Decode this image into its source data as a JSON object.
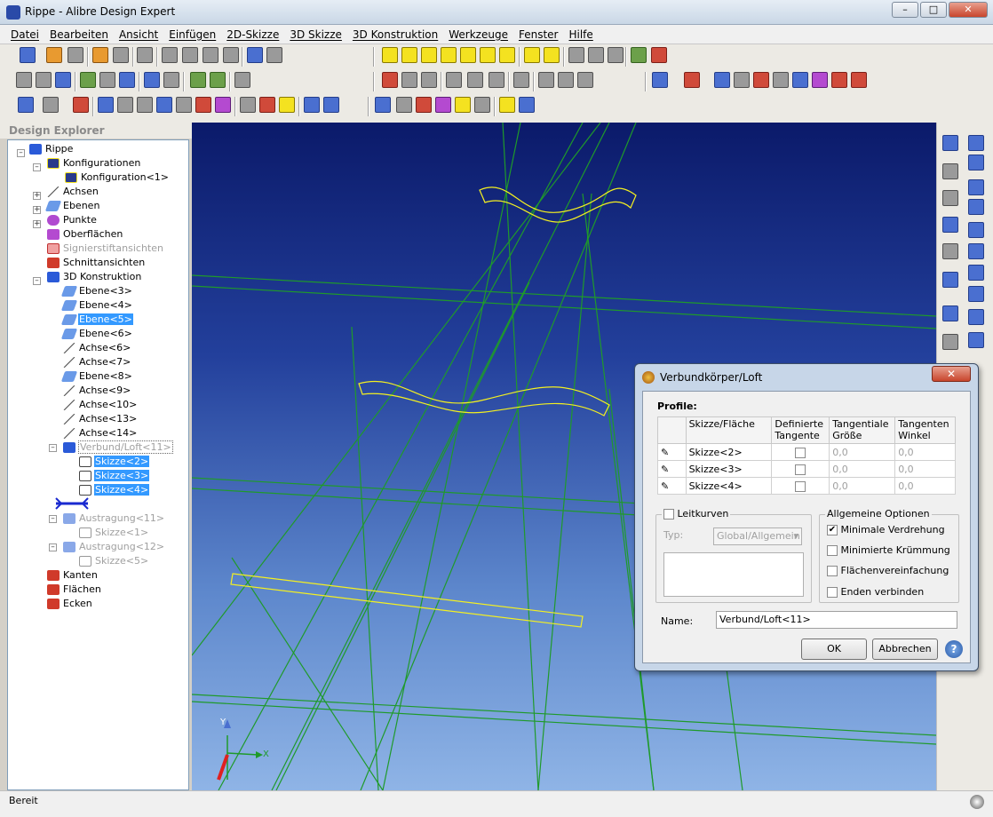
{
  "window": {
    "title": "Rippe - Alibre Design Expert",
    "minimize": "–",
    "maximize": "□",
    "close": "✕"
  },
  "menu": [
    "Datei",
    "Bearbeiten",
    "Ansicht",
    "Einfügen",
    "2D-Skizze",
    "3D Skizze",
    "3D Konstruktion",
    "Werkzeuge",
    "Fenster",
    "Hilfe"
  ],
  "explorer": {
    "title": "Design Explorer",
    "items": [
      {
        "label": "Rippe"
      },
      {
        "label": "Konfigurationen"
      },
      {
        "label": "Konfiguration<1>"
      },
      {
        "label": "Achsen"
      },
      {
        "label": "Ebenen"
      },
      {
        "label": "Punkte"
      },
      {
        "label": "Oberflächen"
      },
      {
        "label": "Signierstiftansichten"
      },
      {
        "label": "Schnittansichten"
      },
      {
        "label": "3D Konstruktion"
      },
      {
        "label": "Ebene<3>"
      },
      {
        "label": "Ebene<4>"
      },
      {
        "label": "Ebene<5>"
      },
      {
        "label": "Ebene<6>"
      },
      {
        "label": "Achse<6>"
      },
      {
        "label": "Achse<7>"
      },
      {
        "label": "Ebene<8>"
      },
      {
        "label": "Achse<9>"
      },
      {
        "label": "Achse<10>"
      },
      {
        "label": "Achse<13>"
      },
      {
        "label": "Achse<14>"
      },
      {
        "label": "Verbund/Loft<11>"
      },
      {
        "label": "Skizze<2>"
      },
      {
        "label": "Skizze<3>"
      },
      {
        "label": "Skizze<4>"
      },
      {
        "label": "Austragung<11>"
      },
      {
        "label": "Skizze<1>"
      },
      {
        "label": "Austragung<12>"
      },
      {
        "label": "Skizze<5>"
      },
      {
        "label": "Kanten"
      },
      {
        "label": "Flächen"
      },
      {
        "label": "Ecken"
      }
    ]
  },
  "viewport": {
    "axis_x": "X",
    "axis_y": "Y"
  },
  "status": {
    "text": "Bereit"
  },
  "dialog": {
    "title": "Verbundkörper/Loft",
    "close": "✕",
    "profiles_label": "Profile:",
    "columns": [
      "Skizze/Fläche",
      "Definierte Tangente",
      "Tangentiale Größe",
      "Tangenten Winkel"
    ],
    "rows": [
      {
        "sketch": "Skizze<2>",
        "size": "0,0",
        "angle": "0,0"
      },
      {
        "sketch": "Skizze<3>",
        "size": "0,0",
        "angle": "0,0"
      },
      {
        "sketch": "Skizze<4>",
        "size": "0,0",
        "angle": "0,0"
      }
    ],
    "guide_curves": {
      "label": "Leitkurven",
      "type_label": "Typ:",
      "type_value": "Global/Allgemein"
    },
    "general": {
      "title": "Allgemeine Optionen",
      "options": [
        {
          "label": "Minimale Verdrehung",
          "checked": "✔"
        },
        {
          "label": "Minimierte Krümmung",
          "checked": ""
        },
        {
          "label": "Flächenvereinfachung",
          "checked": ""
        },
        {
          "label": "Enden verbinden",
          "checked": ""
        }
      ]
    },
    "name_label": "Name:",
    "name_value": "Verbund/Loft<11>",
    "ok": "OK",
    "cancel": "Abbrechen",
    "help": "?"
  }
}
